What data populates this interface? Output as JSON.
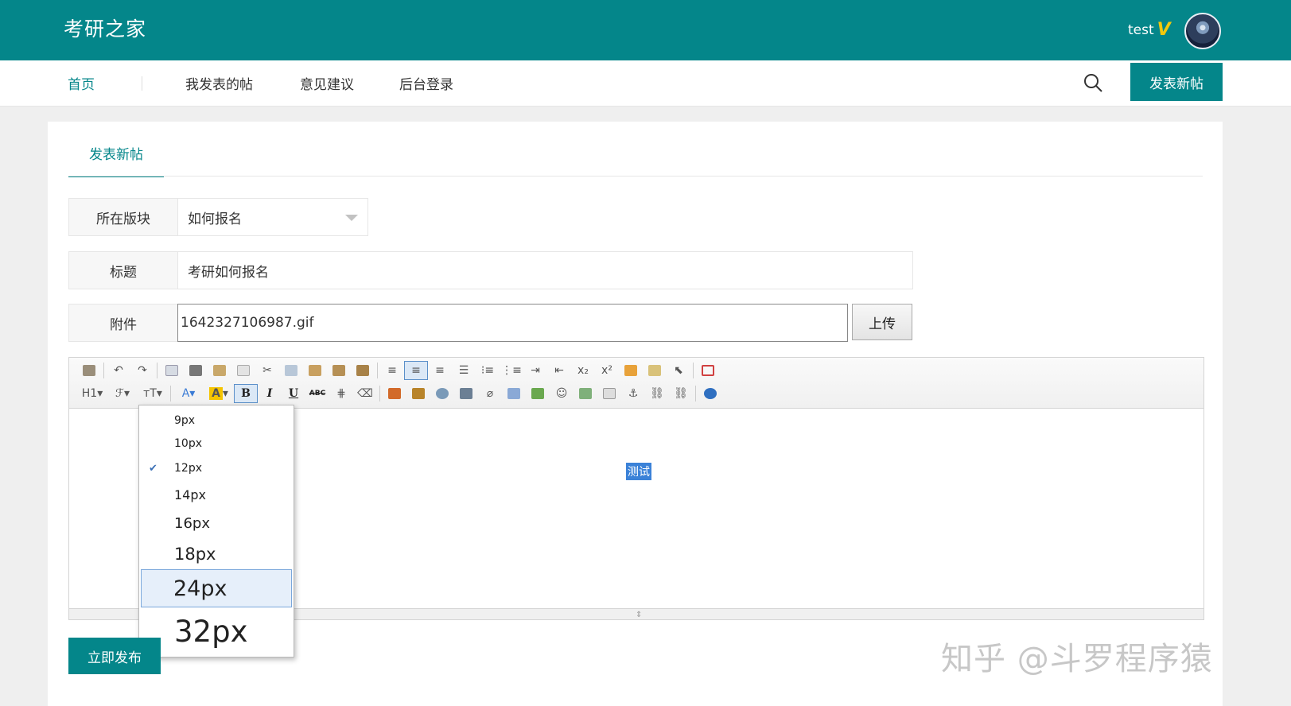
{
  "header": {
    "logo": "考研之家",
    "username": "test",
    "vip_badge": "V"
  },
  "nav": {
    "items": [
      "首页",
      "我发表的帖",
      "意见建议",
      "后台登录"
    ],
    "new_post_label": "发表新帖"
  },
  "form": {
    "tab_label": "发表新帖",
    "board_label": "所在版块",
    "board_value": "如何报名",
    "title_label": "标题",
    "title_value": "考研如何报名",
    "attachment_label": "附件",
    "attachment_value": "1642327106987.gif",
    "upload_label": "上传",
    "publish_label": "立即发布"
  },
  "editor": {
    "toolbar_text": {
      "heading": "H1",
      "fontfamily": "ℱ",
      "fontsize": "тT",
      "forecolor": "A",
      "backcolor": "A",
      "bold": "B",
      "italic": "I",
      "underline": "U",
      "strike": "ABC",
      "subscript": "x₂",
      "superscript": "x²"
    },
    "content_text": "测试"
  },
  "font_size_menu": {
    "items": [
      "9px",
      "10px",
      "12px",
      "14px",
      "16px",
      "18px",
      "24px",
      "32px"
    ],
    "checked": "12px",
    "hovered": "24px"
  },
  "watermark": "知乎 @斗罗程序猿"
}
